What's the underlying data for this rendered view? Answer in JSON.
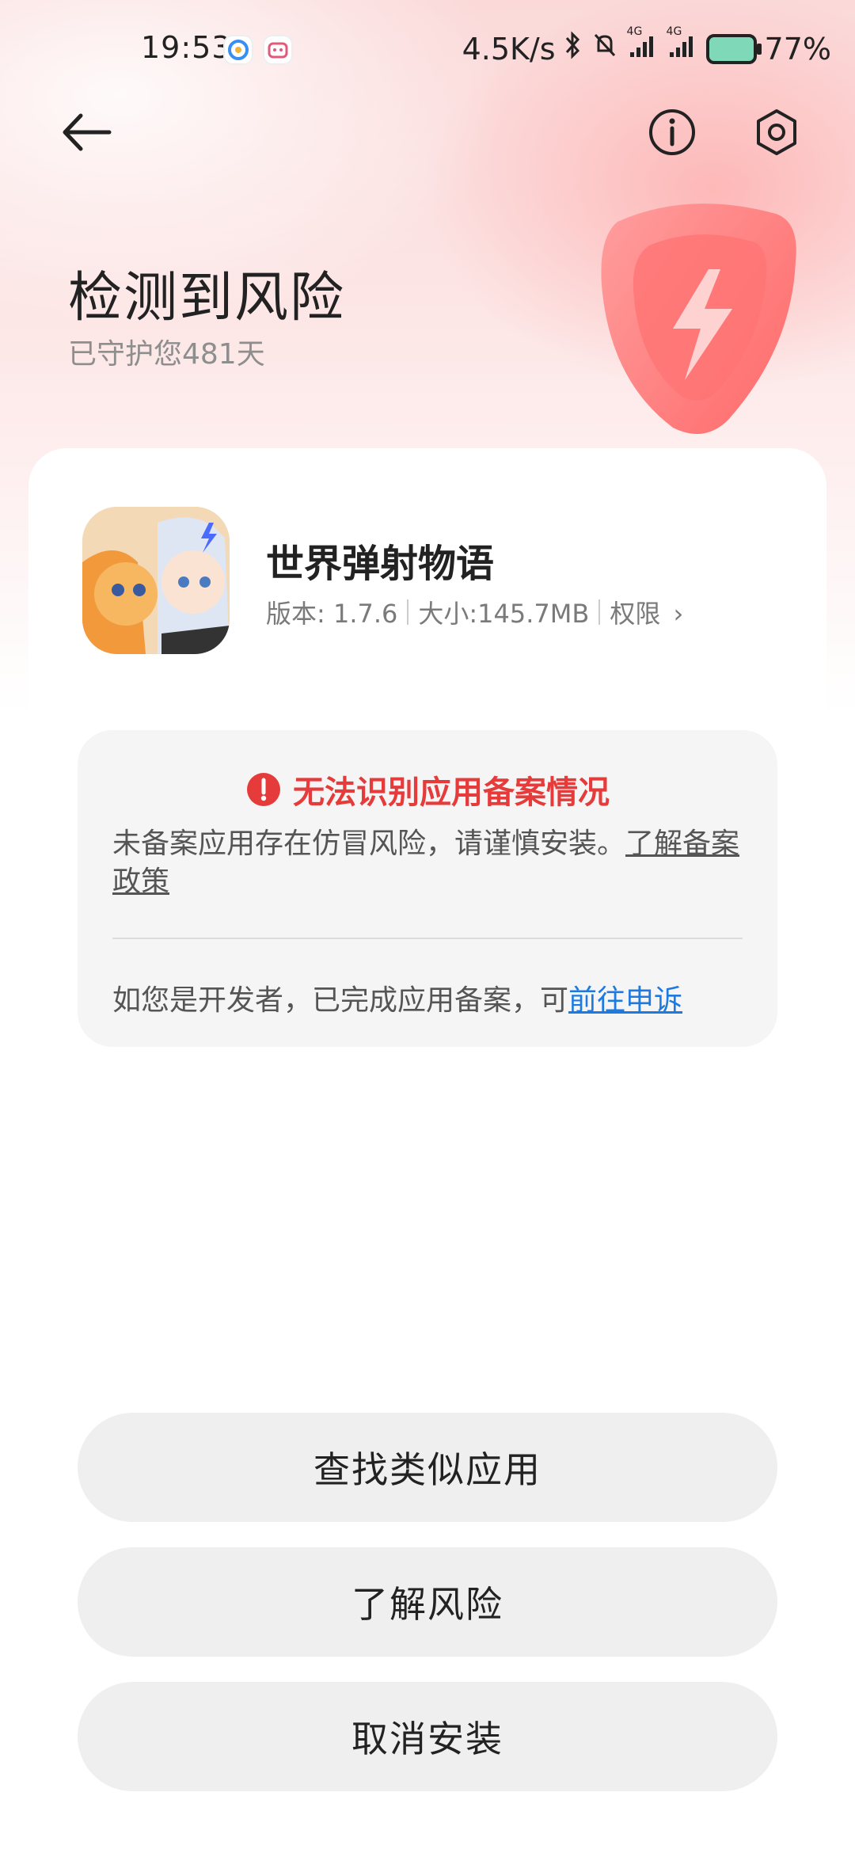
{
  "status_bar": {
    "time": "19:53",
    "network_speed": "4.5K/s",
    "signal_1_label": "4G",
    "signal_2_label": "4G",
    "battery": "77%"
  },
  "header": {
    "title": "检测到风险",
    "subtitle": "已守护您481天"
  },
  "app": {
    "name": "世界弹射物语",
    "version": "版本: 1.7.6",
    "size": "大小:145.7MB",
    "permissions": "权限",
    "chevron": "›"
  },
  "warning": {
    "title": "无法识别应用备案情况",
    "body": "未备案应用存在仿冒风险，请谨慎安装。",
    "policy_link": "了解备案政策",
    "footer_text": "如您是开发者，已完成应用备案，可",
    "appeal_link": "前往申诉"
  },
  "buttons": {
    "find_similar": "查找类似应用",
    "learn_risk": "了解风险",
    "cancel_install": "取消安装"
  },
  "colors": {
    "danger": "#e53b3b",
    "link": "#1f7ae0",
    "button_bg": "#efefef"
  }
}
